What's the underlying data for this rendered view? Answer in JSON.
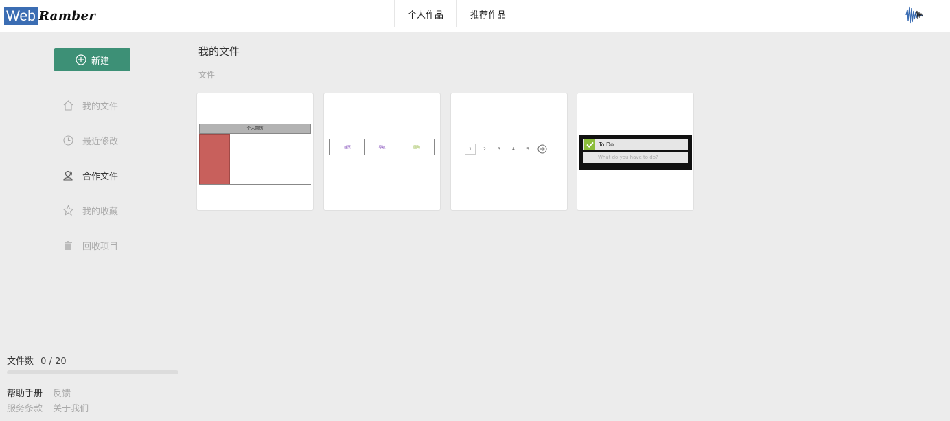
{
  "brand": {
    "logo_word": "Web",
    "logo_script": "Ramber"
  },
  "top_nav": {
    "tabs": [
      {
        "label": "个人作品"
      },
      {
        "label": "推荐作品"
      }
    ]
  },
  "sidebar": {
    "new_button": "新建",
    "items": [
      {
        "label": "我的文件",
        "icon": "home-icon"
      },
      {
        "label": "最近修改",
        "icon": "clock-icon"
      },
      {
        "label": "合作文件",
        "icon": "users-icon"
      },
      {
        "label": "我的收藏",
        "icon": "star-icon"
      },
      {
        "label": "回收项目",
        "icon": "trash-icon"
      }
    ],
    "file_count_label": "文件数",
    "file_count_value": "0 / 20",
    "file_usage_fraction": 0,
    "footer_links": {
      "help": "帮助手册",
      "feedback": "反馈",
      "terms": "服务条款",
      "about": "关于我们"
    }
  },
  "main": {
    "title": "我的文件",
    "breadcrumb": "文件",
    "cards": [
      {
        "header_text": "个人简历"
      },
      {
        "nav_items": [
          "首页",
          "导航",
          "回购"
        ]
      },
      {
        "pages": [
          "1",
          "2",
          "3",
          "4",
          "5"
        ]
      },
      {
        "todo_title": "To Do",
        "todo_placeholder": "What do you have to do?"
      }
    ]
  },
  "colors": {
    "primary": "#3d9076",
    "logo_blue": "#3b6db3",
    "todo_green": "#8bbd3a",
    "resume_red": "#c8605c"
  }
}
